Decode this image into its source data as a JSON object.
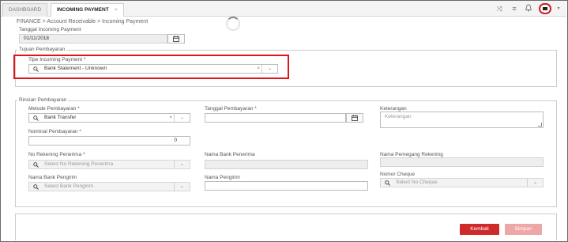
{
  "tabs": [
    {
      "label": "DASHBOARD"
    },
    {
      "label": "INCOMING PAYMENT",
      "close": "×"
    }
  ],
  "breadcrumb": "FINANCE > Account Receivable > Incoming Payment",
  "header": {
    "tanggal_label": "Tanggal Incoming Payment",
    "tanggal_value": "01/11/2018"
  },
  "tujuan": {
    "legend": "Tujuan Pembayaran",
    "tipe_label": "Tipe Incoming Payment *",
    "tipe_value": "Bank Statement - Unknown"
  },
  "rincian": {
    "legend": "Rincian Pembayaran",
    "metode_label": "Metode Pembayaran *",
    "metode_value": "Bank Transfer",
    "tanggal_bayar_label": "Tanggal Pembayaran *",
    "tanggal_bayar_value": "",
    "keterangan_label": "Keterangan",
    "keterangan_placeholder": "Keterangan",
    "nominal_label": "Nominal Pembayaran *",
    "nominal_value": "0",
    "norek_label": "No Rekening Penerima *",
    "norek_placeholder": "Select No Rekening Penerima",
    "nama_bank_penerima_label": "Nama Bank Penerima",
    "nama_pemegang_label": "Nama Pemegang Rekening",
    "nama_bank_pengirim_label": "Nama Bank Pengirim",
    "nama_bank_pengirim_placeholder": "Select Bank Pengirim",
    "nama_pengirim_label": "Nama Pengirim",
    "nomor_cheque_label": "Nomor Cheque",
    "nomor_cheque_placeholder": "Select No Cheque"
  },
  "buttons": {
    "back": "Kembali",
    "save": "Simpan"
  },
  "icons": {
    "clear": "×",
    "chevron": "v"
  }
}
